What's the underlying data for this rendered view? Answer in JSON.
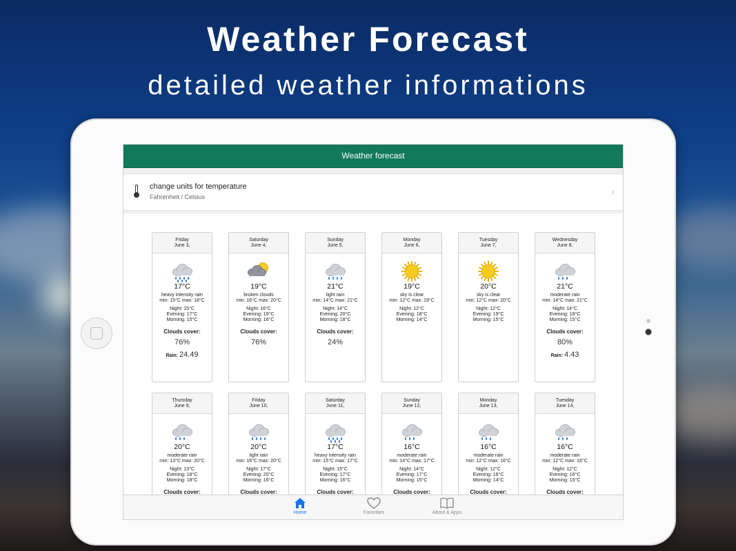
{
  "hero": {
    "title": "Weather Forecast",
    "subtitle": "detailed weather informations"
  },
  "app": {
    "nav_title": "Weather forecast",
    "units": {
      "title": "change units for temperature",
      "subtitle": "Fahrenheit / Celsius",
      "icon": "thermometer-icon"
    },
    "labels": {
      "clouds": "Clouds cover:",
      "rain": "Rain:"
    },
    "days": [
      {
        "weekday": "Friday",
        "date": "June 3,",
        "icon": "heavy-rain-icon",
        "temp": "17°C",
        "desc": "heavy intensity rain",
        "minmax": "min: 15°C max: 18°C",
        "night": "Night: 15°C",
        "evening": "Evening: 17°C",
        "morning": "Morning: 15°C",
        "clouds": "76%",
        "rain": "24.49"
      },
      {
        "weekday": "Saturday",
        "date": "June 4,",
        "icon": "broken-clouds-icon",
        "temp": "19°C",
        "desc": "broken clouds",
        "minmax": "min: 16°C max: 20°C",
        "night": "Night: 16°C",
        "evening": "Evening: 19°C",
        "morning": "Morning: 16°C",
        "clouds": "76%",
        "rain": ""
      },
      {
        "weekday": "Sunday",
        "date": "June 5,",
        "icon": "light-rain-icon",
        "temp": "21°C",
        "desc": "light rain",
        "minmax": "min: 14°C max: 21°C",
        "night": "Night: 14°C",
        "evening": "Evening: 20°C",
        "morning": "Morning: 18°C",
        "clouds": "24%",
        "rain": ""
      },
      {
        "weekday": "Monday",
        "date": "June 6,",
        "icon": "sun-icon",
        "temp": "19°C",
        "desc": "sky is clear",
        "minmax": "min: 12°C max: 19°C",
        "night": "Night: 12°C",
        "evening": "Evening: 18°C",
        "morning": "Morning: 14°C",
        "clouds": "",
        "rain": ""
      },
      {
        "weekday": "Tuesday",
        "date": "June 7,",
        "icon": "sun-icon",
        "temp": "20°C",
        "desc": "sky is clear",
        "minmax": "min: 12°C max: 20°C",
        "night": "Night: 12°C",
        "evening": "Evening: 19°C",
        "morning": "Morning: 15°C",
        "clouds": "",
        "rain": ""
      },
      {
        "weekday": "Wednesday",
        "date": "June 8,",
        "icon": "moderate-rain-icon",
        "temp": "21°C",
        "desc": "moderate rain",
        "minmax": "min: 14°C max: 21°C",
        "night": "Night: 14°C",
        "evening": "Evening: 18°C",
        "morning": "Morning: 15°C",
        "clouds": "80%",
        "rain": "4.43"
      },
      {
        "weekday": "Thursday",
        "date": "June 9,",
        "icon": "moderate-rain-icon",
        "temp": "20°C",
        "desc": "moderate rain",
        "minmax": "min: 13°C max: 20°C",
        "night": "Night: 13°C",
        "evening": "Evening: 18°C",
        "morning": "Morning: 18°C",
        "clouds": "",
        "rain": ""
      },
      {
        "weekday": "Friday",
        "date": "June 10,",
        "icon": "light-rain-icon",
        "temp": "20°C",
        "desc": "light rain",
        "minmax": "min: 16°C max: 20°C",
        "night": "Night: 17°C",
        "evening": "Evening: 20°C",
        "morning": "Morning: 16°C",
        "clouds": "",
        "rain": ""
      },
      {
        "weekday": "Saturday",
        "date": "June 11,",
        "icon": "heavy-rain-icon",
        "temp": "17°C",
        "desc": "heavy intensity rain",
        "minmax": "min: 15°C max: 17°C",
        "night": "Night: 15°C",
        "evening": "Evening: 17°C",
        "morning": "Morning: 16°C",
        "clouds": "",
        "rain": ""
      },
      {
        "weekday": "Sunday",
        "date": "June 12,",
        "icon": "moderate-rain-icon",
        "temp": "16°C",
        "desc": "moderate rain",
        "minmax": "min: 14°C max: 17°C",
        "night": "Night: 14°C",
        "evening": "Evening: 17°C",
        "morning": "Morning: 15°C",
        "clouds": "",
        "rain": ""
      },
      {
        "weekday": "Monday",
        "date": "June 13,",
        "icon": "moderate-rain-icon",
        "temp": "16°C",
        "desc": "moderate rain",
        "minmax": "min: 12°C max: 16°C",
        "night": "Night: 12°C",
        "evening": "Evening: 16°C",
        "morning": "Morning: 14°C",
        "clouds": "",
        "rain": ""
      },
      {
        "weekday": "Tuesday",
        "date": "June 14,",
        "icon": "moderate-rain-icon",
        "temp": "16°C",
        "desc": "moderate rain",
        "minmax": "min: 12°C max: 16°C",
        "night": "Night: 12°C",
        "evening": "Evening: 16°C",
        "morning": "Morning: 15°C",
        "clouds": "",
        "rain": ""
      }
    ],
    "tabs": [
      {
        "label": "Home",
        "icon": "home-icon",
        "active": true
      },
      {
        "label": "Favorities",
        "icon": "heart-icon",
        "active": false
      },
      {
        "label": "About & Apps",
        "icon": "book-icon",
        "active": false
      }
    ],
    "colors": {
      "navbar": "#127a5a",
      "active_tab": "#1a73e8"
    }
  }
}
